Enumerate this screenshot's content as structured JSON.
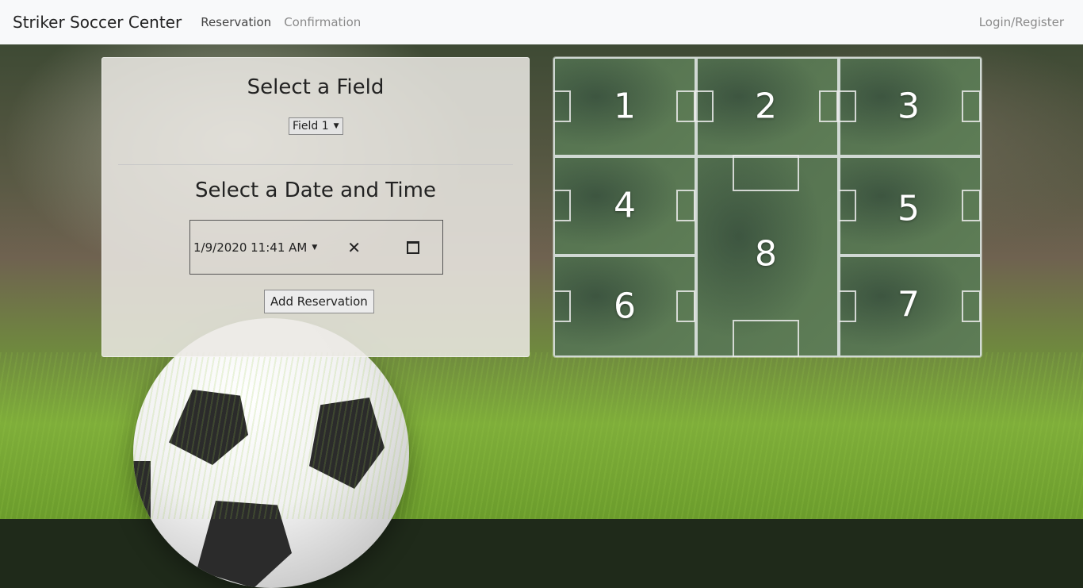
{
  "navbar": {
    "brand": "Striker Soccer Center",
    "links": [
      "Reservation",
      "Confirmation"
    ],
    "right_link": "Login/Register"
  },
  "form": {
    "field_heading": "Select a Field",
    "field_select_value": "Field 1",
    "datetime_heading": "Select a Date and Time",
    "datetime_value": "1/9/2020 11:41  AM",
    "clear_glyph": "✕",
    "add_button": "Add Reservation"
  },
  "field_map": {
    "labels": [
      "1",
      "2",
      "3",
      "4",
      "5",
      "6",
      "7",
      "8"
    ]
  },
  "colors": {
    "navbar_bg": "#f8f9fa",
    "grass": "#5e7d56"
  }
}
